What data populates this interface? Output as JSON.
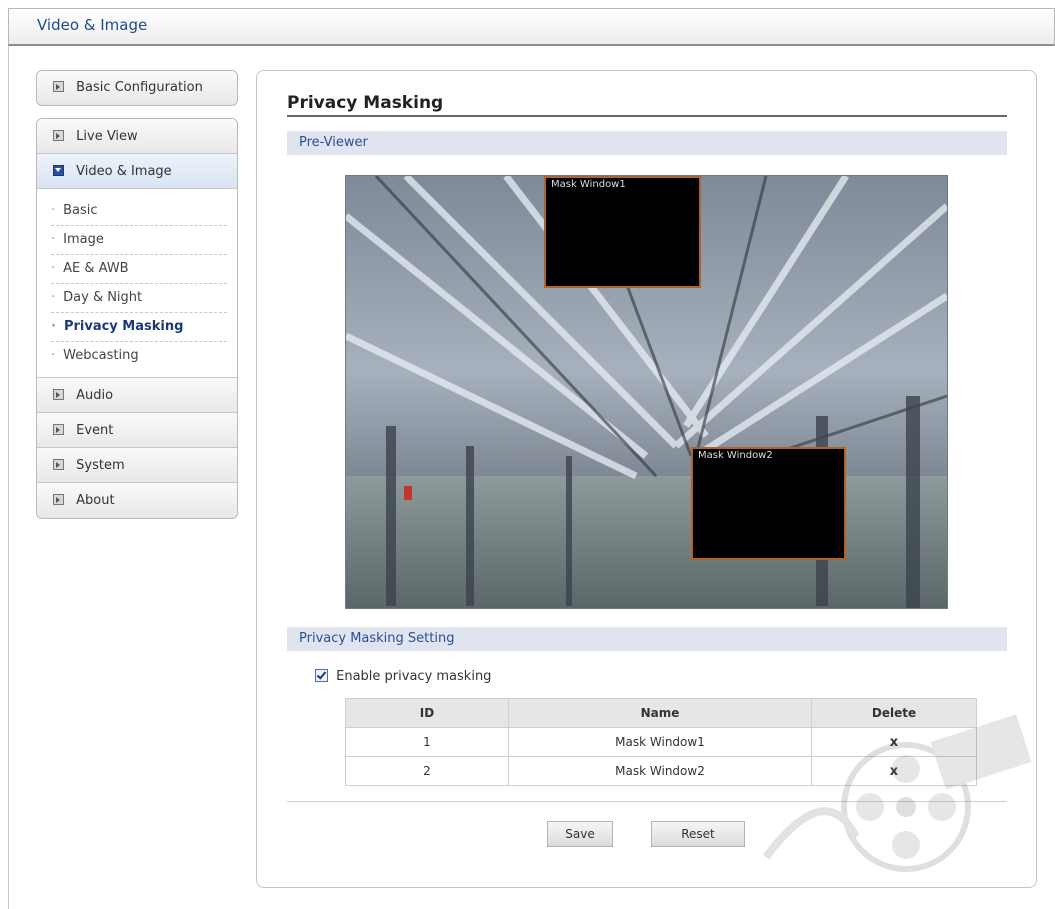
{
  "header": {
    "title": "Video & Image"
  },
  "sidebar": {
    "top_button": "Basic Configuration",
    "items": [
      {
        "label": "Live View",
        "active": false
      },
      {
        "label": "Video & Image",
        "active": true
      },
      {
        "label": "Audio",
        "active": false
      },
      {
        "label": "Event",
        "active": false
      },
      {
        "label": "System",
        "active": false
      },
      {
        "label": "About",
        "active": false
      }
    ],
    "sub_items": [
      {
        "label": "Basic"
      },
      {
        "label": "Image"
      },
      {
        "label": "AE & AWB"
      },
      {
        "label": "Day & Night"
      },
      {
        "label": "Privacy Masking"
      },
      {
        "label": "Webcasting"
      }
    ]
  },
  "main": {
    "title": "Privacy Masking",
    "preview_section": "Pre-Viewer",
    "settings_section": "Privacy Masking Setting",
    "enable_label": "Enable privacy masking",
    "enable_checked": true,
    "viewer": {
      "mask1_label": "Mask Window1",
      "mask2_label": "Mask Window2"
    },
    "table": {
      "headers": {
        "id": "ID",
        "name": "Name",
        "delete": "Delete"
      },
      "rows": [
        {
          "id": "1",
          "name": "Mask Window1",
          "delete": "x"
        },
        {
          "id": "2",
          "name": "Mask Window2",
          "delete": "x"
        }
      ]
    },
    "save_label": "Save",
    "reset_label": "Reset"
  },
  "colors": {
    "accent": "#2a4f9b",
    "section_bg": "#dfe4ee",
    "mask_border": "#b0642a"
  }
}
